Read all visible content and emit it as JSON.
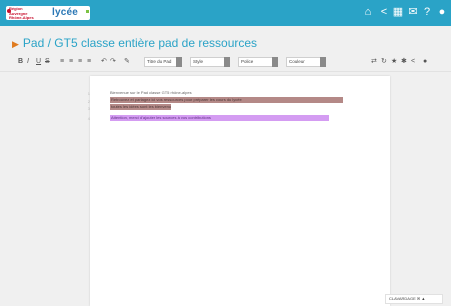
{
  "header": {
    "logo_small": "Région Auvergne Rhône-Alpes",
    "logo_big": "lycée",
    "icons": [
      "home-icon",
      "share-icon",
      "apps-grid-icon",
      "mail-icon",
      "help-icon",
      "user-icon"
    ]
  },
  "pad": {
    "title": "Pad / GT5 classe entière pad de ressources"
  },
  "toolbar": {
    "bold": "B",
    "italic": "I",
    "underline": "U",
    "strike": "S",
    "list_ordered": "≡",
    "list_unordered": "≡",
    "indent": "≡",
    "outdent": "≡",
    "undo": "↶",
    "redo": "↷",
    "clear": "✎",
    "style_select": "Titre du Pad",
    "style_select2": "Style",
    "font_select": "Police",
    "size_select": "Couleur"
  },
  "content": {
    "line1": "Bienvenue sur le Pad  classe GT5 rhône-alpes",
    "line2": "Retrouvez et partagez ici vos ressources pour préparer les cours du lycée",
    "line3": "toutes les idées sont les bienvenues",
    "line4": "Attention, merci d'ajouter les sources à vos contributions"
  },
  "chat": {
    "label": "CLAVARDAGE"
  }
}
